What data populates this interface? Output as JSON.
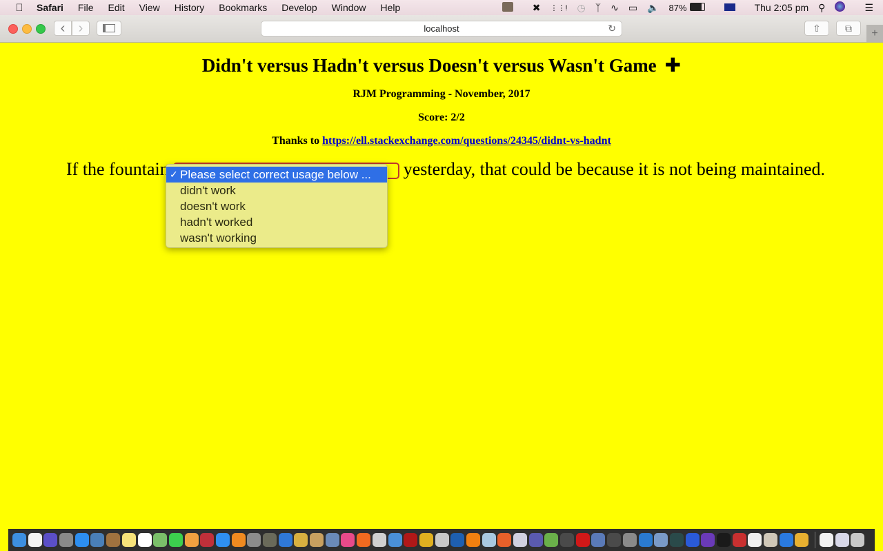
{
  "menubar": {
    "apple_icon": "apple-logo-icon",
    "app_name": "Safari",
    "items": [
      "File",
      "Edit",
      "View",
      "History",
      "Bookmarks",
      "Develop",
      "Window",
      "Help"
    ],
    "status": {
      "battery_percent": "87%",
      "clock": "Thu 2:05 pm",
      "icons": [
        "dashlane-icon",
        "malwarebytes-icon",
        "network-activity-icon",
        "time-machine-icon",
        "bluetooth-icon",
        "wifi-icon",
        "airplay-icon",
        "volume-icon",
        "battery-icon",
        "australia-flag-icon",
        "spotlight-search-icon",
        "siri-icon",
        "notification-center-icon"
      ]
    }
  },
  "browser": {
    "url": "localhost",
    "buttons": {
      "back": "‹",
      "forward": "›",
      "sidebar": "sidebar-icon",
      "reload": "↻",
      "share": "share-icon",
      "tabs": "tabs-icon",
      "new_tab": "+"
    }
  },
  "page": {
    "title": "Didn't versus Hadn't versus Doesn't versus Wasn't Game",
    "title_plus": "✚",
    "subtitle": "RJM Programming - November, 2017",
    "score_label": "Score: 2/2",
    "thanks_prefix": "Thanks to ",
    "thanks_link": "https://ell.stackexchange.com/questions/24345/didnt-vs-hadnt",
    "sentence_before": "If the fountain",
    "sentence_after": "yesterday, that could be because it is not being maintained."
  },
  "dropdown": {
    "selected_index": 0,
    "options": [
      "Please select correct usage below ...",
      "didn't work",
      "doesn't work",
      "hadn't worked",
      "wasn't working"
    ],
    "accent_color": "#2f6fe6"
  },
  "dock": {
    "apps": [
      {
        "name": "finder",
        "color": "#3d8fe0"
      },
      {
        "name": "textedit-doc",
        "color": "#f2f2f2"
      },
      {
        "name": "siri",
        "color": "#5b4fc8"
      },
      {
        "name": "launchpad",
        "color": "#8a8a8a"
      },
      {
        "name": "safari",
        "color": "#2d8ef0"
      },
      {
        "name": "preview",
        "color": "#4a7fb8"
      },
      {
        "name": "contacts",
        "color": "#a0723f"
      },
      {
        "name": "notes",
        "color": "#f6e27a"
      },
      {
        "name": "calendar",
        "color": "#ffffff"
      },
      {
        "name": "maps",
        "color": "#7bbf6a"
      },
      {
        "name": "facetime",
        "color": "#3ccf4e"
      },
      {
        "name": "photos",
        "color": "#f0a040"
      },
      {
        "name": "photo-booth",
        "color": "#c0303a"
      },
      {
        "name": "app-store",
        "color": "#2f8ff0"
      },
      {
        "name": "ibooks",
        "color": "#f08a20"
      },
      {
        "name": "system-preferences",
        "color": "#8c8c8c"
      },
      {
        "name": "gimp",
        "color": "#6a6a5a"
      },
      {
        "name": "xcode",
        "color": "#2f78d8"
      },
      {
        "name": "wordpress-app",
        "color": "#d8b040"
      },
      {
        "name": "script-editor",
        "color": "#c8a060"
      },
      {
        "name": "image-capture",
        "color": "#6a8ab8"
      },
      {
        "name": "itunes",
        "color": "#e84a8a"
      },
      {
        "name": "avast",
        "color": "#f06a20"
      },
      {
        "name": "grapher",
        "color": "#d0d0d0"
      },
      {
        "name": "screen-sharing",
        "color": "#4a90d8"
      },
      {
        "name": "filezilla",
        "color": "#b01818"
      },
      {
        "name": "chrome",
        "color": "#e0b020"
      },
      {
        "name": "gimp-alt",
        "color": "#c8c8c8"
      },
      {
        "name": "quicktime",
        "color": "#1e5fb0"
      },
      {
        "name": "vlc",
        "color": "#f08010"
      },
      {
        "name": "cube-app",
        "color": "#a8c8e0"
      },
      {
        "name": "firefox",
        "color": "#e8602a"
      },
      {
        "name": "mindnode",
        "color": "#d0d0e0"
      },
      {
        "name": "php",
        "color": "#5a5ab0"
      },
      {
        "name": "android-studio",
        "color": "#6ab04a"
      },
      {
        "name": "unknown-app",
        "color": "#4a4a4a"
      },
      {
        "name": "opera",
        "color": "#d01818"
      },
      {
        "name": "virtualbox",
        "color": "#5a7ab8"
      },
      {
        "name": "unknown-app-2",
        "color": "#4a4a4a"
      },
      {
        "name": "keychain-access",
        "color": "#8a8a8a"
      },
      {
        "name": "visual-studio-code",
        "color": "#2a7ad0"
      },
      {
        "name": "image-viewer",
        "color": "#7a9ac8"
      },
      {
        "name": "network-radar",
        "color": "#2a4a4a"
      },
      {
        "name": "migration",
        "color": "#2a5ad8"
      },
      {
        "name": "github-desktop",
        "color": "#6a3ab8"
      },
      {
        "name": "terminal",
        "color": "#1a1a1a"
      },
      {
        "name": "dots-app",
        "color": "#c83030"
      },
      {
        "name": "drop-app",
        "color": "#f0f0f0"
      },
      {
        "name": "font-book",
        "color": "#d0c8b8"
      },
      {
        "name": "simulator",
        "color": "#2a7ae0"
      },
      {
        "name": "keyboard-maestro",
        "color": "#e8b030"
      },
      {
        "name": "separator",
        "color": ""
      },
      {
        "name": "downloads-stack",
        "color": "#f0f0f0"
      },
      {
        "name": "documents-stack",
        "color": "#d8d8e8"
      },
      {
        "name": "trash",
        "color": "#c8c8c8"
      }
    ]
  }
}
